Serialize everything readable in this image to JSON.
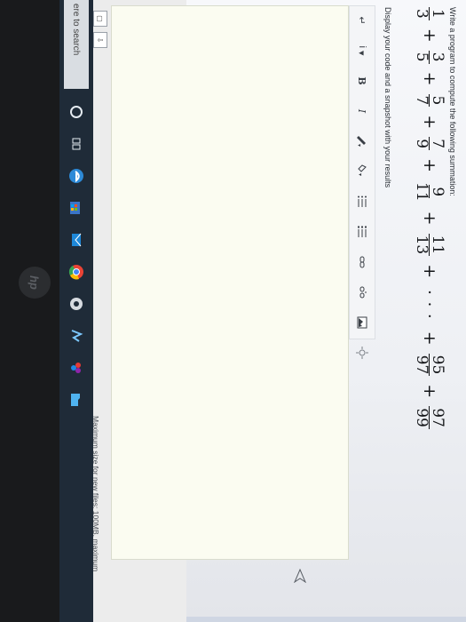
{
  "question": {
    "prompt": "Write a program to compute the following summation:",
    "instruction": "Display your code and a snapshot with your results"
  },
  "formula": {
    "terms": [
      {
        "num": "1",
        "den": "3"
      },
      {
        "num": "3",
        "den": "5"
      },
      {
        "num": "5",
        "den": "7"
      },
      {
        "num": "7",
        "den": "9"
      },
      {
        "num": "9",
        "den": "11"
      },
      {
        "num": "11",
        "den": "13"
      },
      {
        "num": "95",
        "den": "97"
      },
      {
        "num": "97",
        "den": "99"
      }
    ],
    "plus": "+",
    "ellipsis": "· · ·"
  },
  "toolbar": {
    "paragraph": "↵",
    "info": "i",
    "bold": "B",
    "italic": "I"
  },
  "editor": {
    "max_size_text": "Maximum size for new files: 100MB, maximum"
  },
  "taskbar": {
    "search_text": "ere to search"
  },
  "colors": {
    "taskbar": "#1f2b38",
    "editor_bg": "#fbfcf1",
    "page_bg": "#f4f5f7"
  },
  "icons": [
    "paragraph-icon",
    "info-icon",
    "bold-icon",
    "italic-icon",
    "pen-icon",
    "color-icon",
    "unordered-list-icon",
    "ordered-list-icon",
    "link-icon",
    "unlink-icon",
    "image-icon",
    "media-icon",
    "file-icon",
    "upload-icon",
    "cursor-icon",
    "cortana-icon",
    "task-view-icon",
    "edge-icon",
    "store-icon",
    "mail-icon",
    "chrome-icon",
    "media-app-icon",
    "maps-icon",
    "paint-icon",
    "folder-icon"
  ]
}
